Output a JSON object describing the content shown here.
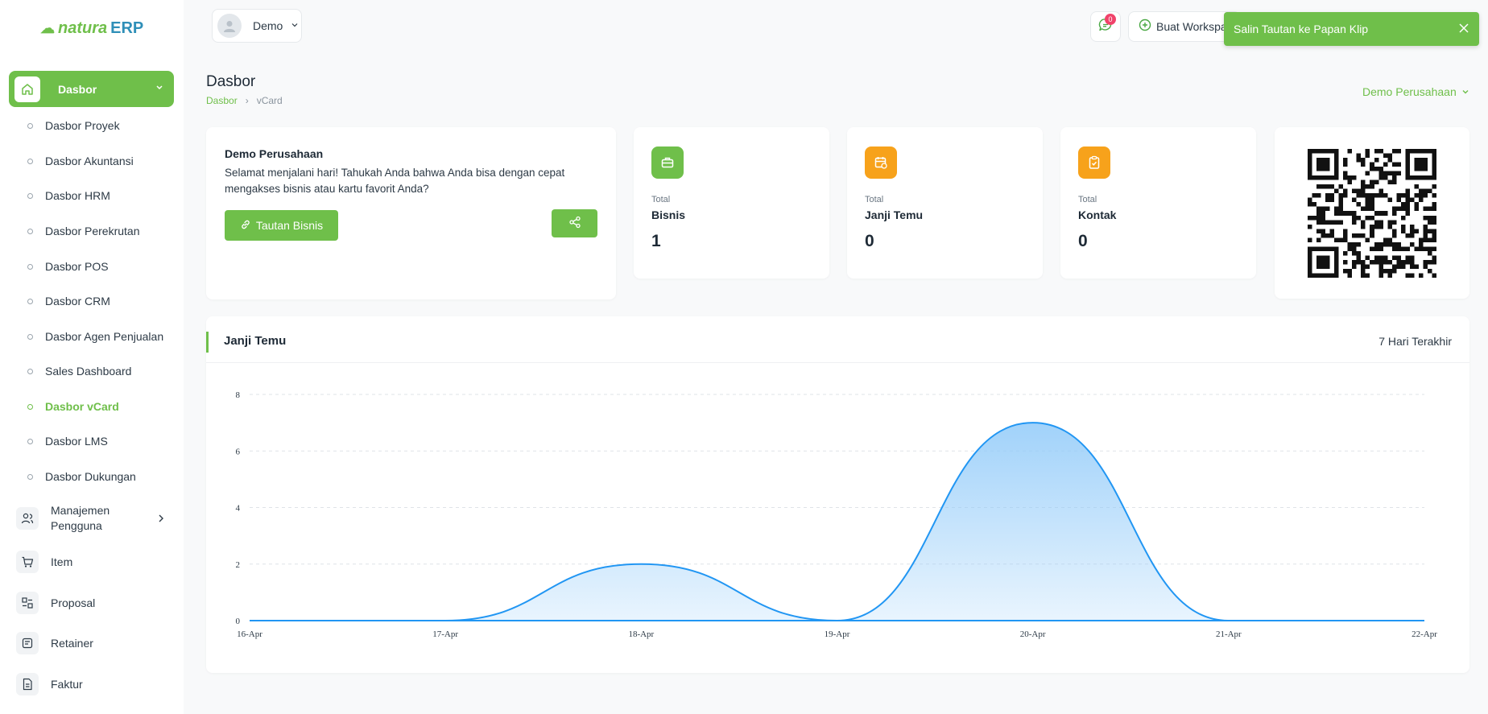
{
  "brand": {
    "logo_main": "natura",
    "logo_suffix": "ERP"
  },
  "header": {
    "user_name": "Demo",
    "message_count": "0",
    "workspace_label": "Buat Workspace",
    "toast_text": "Salin Tautan ke Papan Klip"
  },
  "sidebar": {
    "active_label": "Dasbor",
    "sub_items": [
      {
        "label": "Dasbor Proyek"
      },
      {
        "label": "Dasbor Akuntansi"
      },
      {
        "label": "Dasbor HRM"
      },
      {
        "label": "Dasbor Perekrutan"
      },
      {
        "label": "Dasbor POS"
      },
      {
        "label": "Dasbor CRM"
      },
      {
        "label": "Dasbor Agen Penjualan"
      },
      {
        "label": "Sales Dashboard"
      },
      {
        "label": "Dasbor vCard"
      },
      {
        "label": "Dasbor LMS"
      },
      {
        "label": "Dasbor Dukungan"
      }
    ],
    "main_items": [
      {
        "label_line1": "Manajemen",
        "label_line2": "Pengguna",
        "icon": "users-icon"
      },
      {
        "label": "Item",
        "icon": "cart-icon"
      },
      {
        "label": "Proposal",
        "icon": "proposal-icon"
      },
      {
        "label": "Retainer",
        "icon": "retainer-icon"
      },
      {
        "label": "Faktur",
        "icon": "invoice-icon"
      }
    ]
  },
  "page": {
    "title": "Dasbor",
    "breadcrumb_home": "Dasbor",
    "breadcrumb_sep": "›",
    "breadcrumb_current": "vCard",
    "company_selector": "Demo Perusahaan"
  },
  "welcome": {
    "title": "Demo Perusahaan",
    "text": "Selamat menjalani hari! Tahukah Anda bahwa Anda bisa dengan cepat mengakses bisnis atau kartu favorit Anda?",
    "link_button": "Tautan Bisnis"
  },
  "stats": [
    {
      "small": "Total",
      "label": "Bisnis",
      "value": "1",
      "color": "#6fbf4a",
      "icon": "briefcase-icon"
    },
    {
      "small": "Total",
      "label": "Janji Temu",
      "value": "0",
      "color": "#f7a21b",
      "icon": "calendar-icon"
    },
    {
      "small": "Total",
      "label": "Kontak",
      "value": "0",
      "color": "#f7a21b",
      "icon": "clipboard-icon"
    }
  ],
  "chart_card": {
    "title": "Janji Temu",
    "range": "7 Hari Terakhir"
  },
  "chart_data": {
    "type": "area",
    "categories": [
      "16-Apr",
      "17-Apr",
      "18-Apr",
      "19-Apr",
      "20-Apr",
      "21-Apr",
      "22-Apr"
    ],
    "values": [
      0,
      0,
      2,
      0,
      7,
      0,
      0
    ],
    "y_ticks": [
      0,
      2,
      4,
      6,
      8
    ],
    "ylim": [
      0,
      8
    ],
    "grid": true,
    "colors": {
      "line": "#2196f3",
      "fill": "#90caf9"
    }
  },
  "colors": {
    "accent": "#6fbf4a",
    "orange": "#f7a21b"
  }
}
